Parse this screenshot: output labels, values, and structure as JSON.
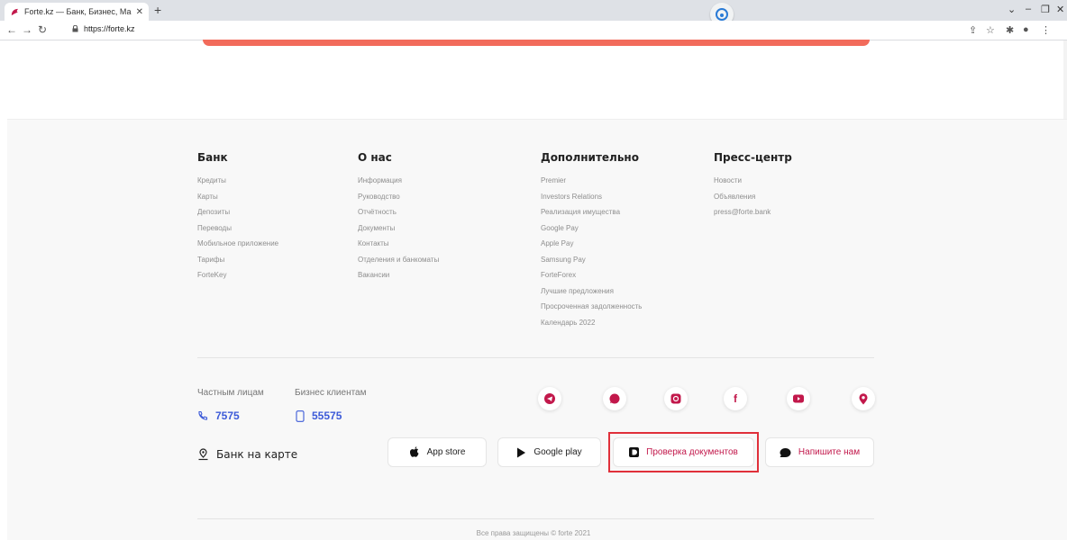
{
  "browser": {
    "tab_title": "Forte.kz — Банк, Бизнес, Маркет",
    "tab_close": "✕",
    "new_tab": "+",
    "url": "https://forte.kz",
    "accent": "#f26b5b"
  },
  "footer": {
    "columns": [
      {
        "title": "Банк",
        "links": [
          "Кредиты",
          "Карты",
          "Депозиты",
          "Переводы",
          "Мобильное приложение",
          "Тарифы",
          "ForteKey"
        ]
      },
      {
        "title": "О нас",
        "links": [
          "Информация",
          "Руководство",
          "Отчётность",
          "Документы",
          "Контакты",
          "Отделения и банкоматы",
          "Вакансии"
        ]
      },
      {
        "title": "Дополнительно",
        "links": [
          "Premier",
          "Investors Relations",
          "Реализация имущества",
          "Google Pay",
          "Apple Pay",
          "Samsung Pay",
          "ForteForex",
          "Лучшие предложения",
          "Просроченная задолженность",
          "Календарь 2022"
        ]
      },
      {
        "title": "Пресс-центр",
        "links": [
          "Новости",
          "Объявления",
          "press@forte.bank"
        ]
      }
    ],
    "contacts": {
      "private_label": "Частным лицам",
      "private_phone": "7575",
      "business_label": "Бизнес клиентам",
      "business_phone": "55575"
    },
    "social_icons": [
      "telegram-icon",
      "whatsapp-icon",
      "instagram-icon",
      "facebook-icon",
      "youtube-icon",
      "location-icon"
    ],
    "map_link": "Банк на карте",
    "buttons": {
      "app_store": "App store",
      "google_play": "Google play",
      "check_docs": "Проверка документов",
      "write_us": "Напишите нам"
    },
    "copyright": "Все права защищены © forte 2021",
    "brand_color": "#c2184b",
    "phone_color": "#3d5bd8"
  }
}
